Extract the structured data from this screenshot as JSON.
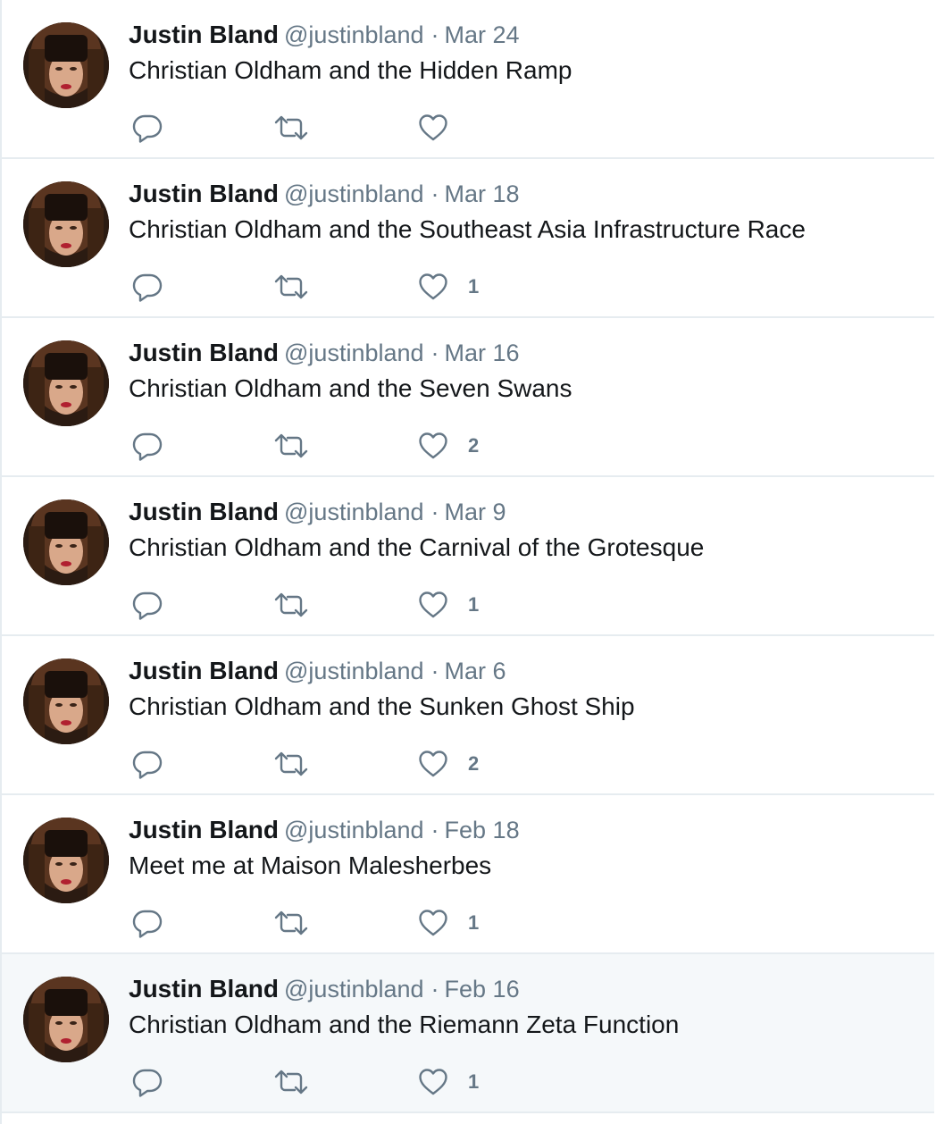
{
  "timeline": {
    "tweets": [
      {
        "name": "Justin Bland",
        "handle": "@justinbland",
        "date": "Mar 24",
        "text": "Christian Oldham and the Hidden Ramp",
        "likes": ""
      },
      {
        "name": "Justin Bland",
        "handle": "@justinbland",
        "date": "Mar 18",
        "text": "Christian Oldham and the Southeast Asia Infrastructure Race",
        "likes": "1"
      },
      {
        "name": "Justin Bland",
        "handle": "@justinbland",
        "date": "Mar 16",
        "text": "Christian Oldham and the Seven Swans",
        "likes": "2"
      },
      {
        "name": "Justin Bland",
        "handle": "@justinbland",
        "date": "Mar 9",
        "text": "Christian Oldham and the Carnival of the Grotesque",
        "likes": "1"
      },
      {
        "name": "Justin Bland",
        "handle": "@justinbland",
        "date": "Mar 6",
        "text": "Christian Oldham and the Sunken Ghost Ship",
        "likes": "2"
      },
      {
        "name": "Justin Bland",
        "handle": "@justinbland",
        "date": "Feb 18",
        "text": "Meet me at Maison Malesherbes",
        "likes": "1"
      },
      {
        "name": "Justin Bland",
        "handle": "@justinbland",
        "date": "Feb 16",
        "text": "Christian Oldham and the Riemann Zeta Function",
        "likes": "1"
      }
    ],
    "separator": "·"
  },
  "icons": {
    "reply": "reply-icon",
    "retweet": "retweet-icon",
    "like": "heart-icon",
    "avatar": "profile-photo"
  },
  "colors": {
    "text": "#14171a",
    "secondary": "#657786",
    "icon": "#657786",
    "border": "#e6ecf0",
    "highlight_bg": "#f5f8fa"
  }
}
